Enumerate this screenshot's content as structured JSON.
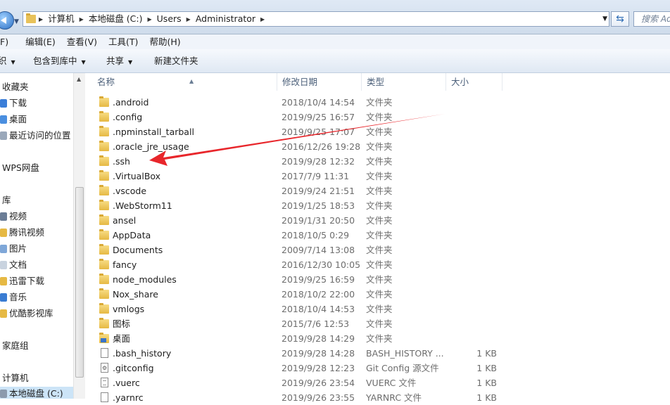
{
  "address": {
    "crumbs": [
      "计算机",
      "本地磁盘 (C:)",
      "Users",
      "Administrator"
    ],
    "search_placeholder": "搜索 Ad"
  },
  "menu": [
    "F)",
    "编辑(E)",
    "查看(V)",
    "工具(T)",
    "帮助(H)"
  ],
  "toolbar": {
    "organize": "织",
    "include_library": "包含到库中",
    "share": "共享",
    "new_folder": "新建文件夹"
  },
  "nav": {
    "favorites": "收藏夹",
    "downloads": "下载",
    "desktop": "桌面",
    "recent": "最近访问的位置",
    "wps": "WPS网盘",
    "libraries": "库",
    "video": "视频",
    "tencent_video": "腾讯视频",
    "pictures": "图片",
    "documents": "文档",
    "xunlei": "迅雷下载",
    "music": "音乐",
    "youku": "优酷影视库",
    "homegroup": "家庭组",
    "computer": "计算机",
    "local_disk": "本地磁盘 (C:)"
  },
  "columns": {
    "name": "名称",
    "date": "修改日期",
    "type": "类型",
    "size": "大小"
  },
  "files": [
    {
      "name": ".android",
      "date": "2018/10/4 14:54",
      "type": "文件夹",
      "size": "",
      "icon": "folder"
    },
    {
      "name": ".config",
      "date": "2019/9/25 16:57",
      "type": "文件夹",
      "size": "",
      "icon": "folder"
    },
    {
      "name": ".npminstall_tarball",
      "date": "2019/9/25 17:07",
      "type": "文件夹",
      "size": "",
      "icon": "folder"
    },
    {
      "name": ".oracle_jre_usage",
      "date": "2016/12/26 19:28",
      "type": "文件夹",
      "size": "",
      "icon": "folder"
    },
    {
      "name": ".ssh",
      "date": "2019/9/28 12:32",
      "type": "文件夹",
      "size": "",
      "icon": "folder"
    },
    {
      "name": ".VirtualBox",
      "date": "2017/7/9 11:31",
      "type": "文件夹",
      "size": "",
      "icon": "folder"
    },
    {
      "name": ".vscode",
      "date": "2019/9/24 21:51",
      "type": "文件夹",
      "size": "",
      "icon": "folder"
    },
    {
      "name": ".WebStorm11",
      "date": "2019/1/25 18:53",
      "type": "文件夹",
      "size": "",
      "icon": "folder"
    },
    {
      "name": "ansel",
      "date": "2019/1/31 20:50",
      "type": "文件夹",
      "size": "",
      "icon": "folder"
    },
    {
      "name": "AppData",
      "date": "2018/10/5 0:29",
      "type": "文件夹",
      "size": "",
      "icon": "folder"
    },
    {
      "name": "Documents",
      "date": "2009/7/14 13:08",
      "type": "文件夹",
      "size": "",
      "icon": "folder"
    },
    {
      "name": "fancy",
      "date": "2016/12/30 10:05",
      "type": "文件夹",
      "size": "",
      "icon": "folder"
    },
    {
      "name": "node_modules",
      "date": "2019/9/25 16:59",
      "type": "文件夹",
      "size": "",
      "icon": "folder"
    },
    {
      "name": "Nox_share",
      "date": "2018/10/2 22:00",
      "type": "文件夹",
      "size": "",
      "icon": "folder"
    },
    {
      "name": "vmlogs",
      "date": "2018/10/4 14:53",
      "type": "文件夹",
      "size": "",
      "icon": "folder"
    },
    {
      "name": "图标",
      "date": "2015/7/6 12:53",
      "type": "文件夹",
      "size": "",
      "icon": "folder"
    },
    {
      "name": "桌面",
      "date": "2019/9/28 14:29",
      "type": "文件夹",
      "size": "",
      "icon": "folder-special"
    },
    {
      "name": ".bash_history",
      "date": "2019/9/28 14:28",
      "type": "BASH_HISTORY ...",
      "size": "1 KB",
      "icon": "file"
    },
    {
      "name": ".gitconfig",
      "date": "2019/9/28 12:23",
      "type": "Git Config 源文件",
      "size": "1 KB",
      "icon": "file-gear"
    },
    {
      "name": ".vuerc",
      "date": "2019/9/26 23:54",
      "type": "VUERC 文件",
      "size": "1 KB",
      "icon": "file-lined"
    },
    {
      "name": ".yarnrc",
      "date": "2019/9/26 23:55",
      "type": "YARNRC 文件",
      "size": "1 KB",
      "icon": "file"
    }
  ],
  "colors": {
    "arrow": "#e8262b",
    "folder": "#e6b944",
    "selection": "#cce4f7"
  }
}
